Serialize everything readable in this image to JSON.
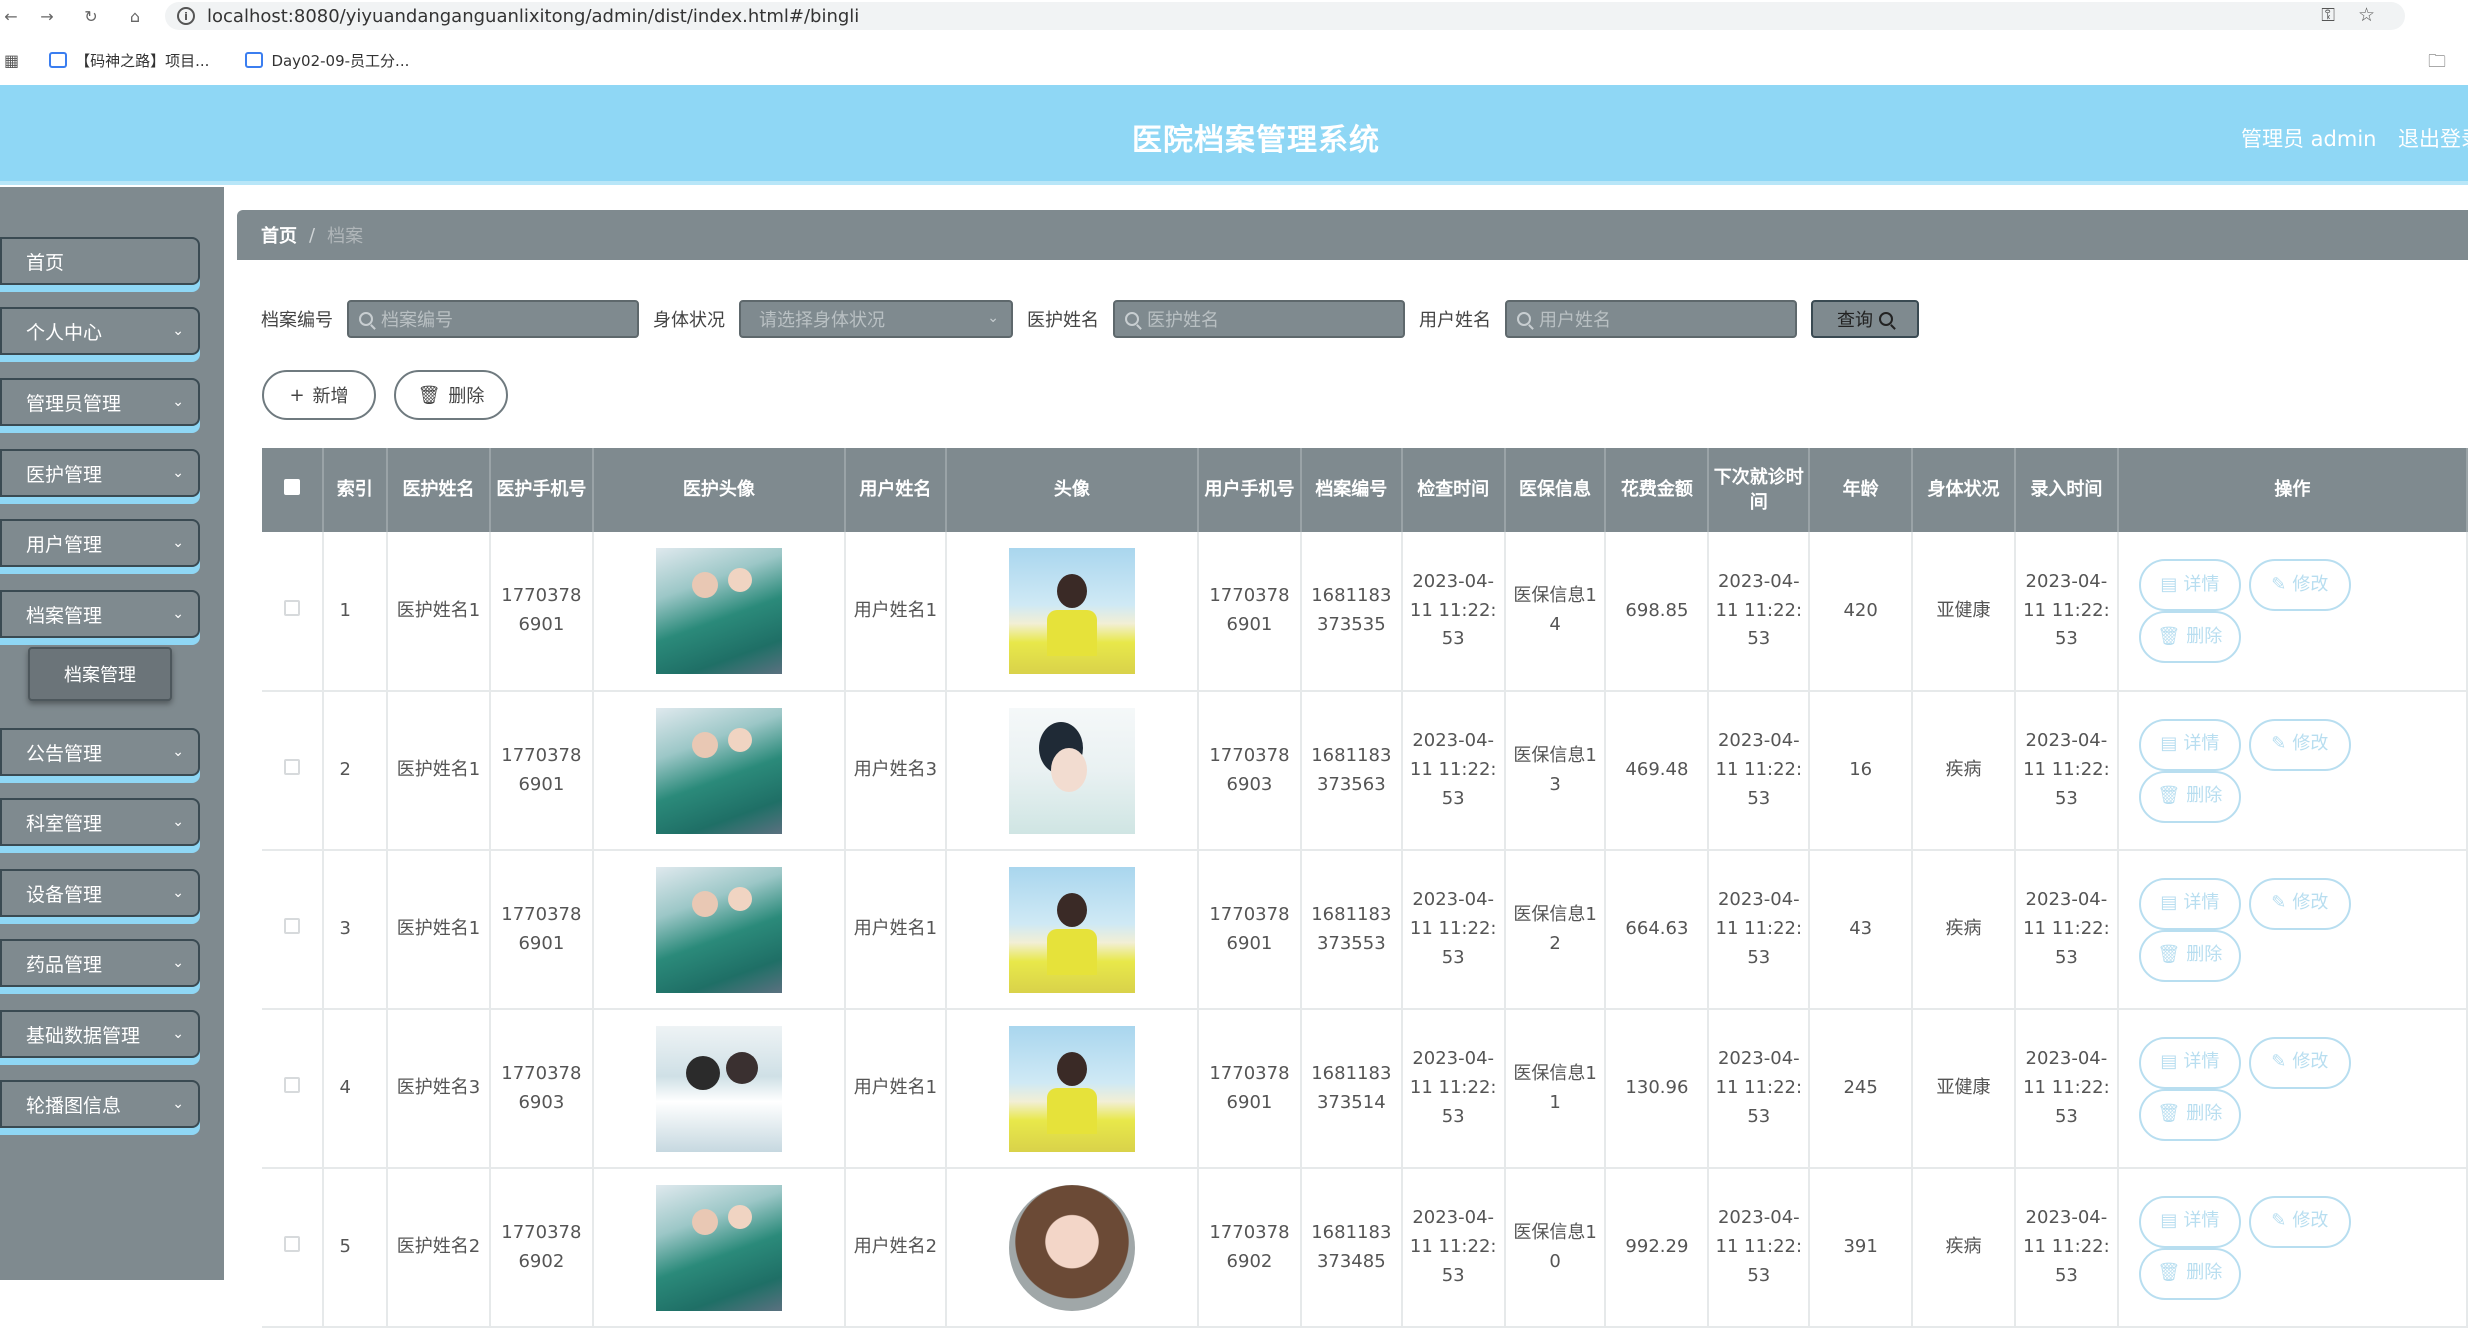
{
  "browser": {
    "url": "localhost:8080/yiyuandanganguanlixitong/admin/dist/index.html#/bingli",
    "bookmarks": [
      "【码神之路】项目...",
      "Day02-09-员工分..."
    ]
  },
  "header": {
    "title": "医院档案管理系统",
    "admin": "管理员 admin",
    "logout": "退出登录"
  },
  "sidebar": {
    "items": [
      {
        "label": "首页",
        "has_chevron": false
      },
      {
        "label": "个人中心",
        "has_chevron": true
      },
      {
        "label": "管理员管理",
        "has_chevron": true
      },
      {
        "label": "医护管理",
        "has_chevron": true
      },
      {
        "label": "用户管理",
        "has_chevron": true
      },
      {
        "label": "档案管理",
        "has_chevron": true
      },
      {
        "label": "公告管理",
        "has_chevron": true
      },
      {
        "label": "科室管理",
        "has_chevron": true
      },
      {
        "label": "设备管理",
        "has_chevron": true
      },
      {
        "label": "药品管理",
        "has_chevron": true
      },
      {
        "label": "基础数据管理",
        "has_chevron": true
      },
      {
        "label": "轮播图信息",
        "has_chevron": true
      }
    ],
    "submenu": {
      "label": "档案管理"
    }
  },
  "breadcrumb": {
    "home": "首页",
    "separator": "/",
    "current": "档案"
  },
  "search": {
    "field1_label": "档案编号",
    "field1_placeholder": "档案编号",
    "field2_label": "身体状况",
    "field2_placeholder": "请选择身体状况",
    "field3_label": "医护姓名",
    "field3_placeholder": "医护姓名",
    "field4_label": "用户姓名",
    "field4_placeholder": "用户姓名",
    "query_label": "查询"
  },
  "actions": {
    "add_label": "新增",
    "delete_label": "删除"
  },
  "table": {
    "headers": {
      "index": "索引",
      "doctor_name": "医护姓名",
      "doctor_phone": "医护手机号",
      "doctor_avatar": "医护头像",
      "user_name": "用户姓名",
      "avatar": "头像",
      "user_phone": "用户手机号",
      "file_no": "档案编号",
      "check_time": "检查时间",
      "insurance": "医保信息",
      "cost": "花费金额",
      "next_visit": "下次就诊时间",
      "age": "年龄",
      "condition": "身体状况",
      "entry_time": "录入时间",
      "ops": "操作"
    },
    "ops": {
      "detail": "详情",
      "edit": "修改",
      "delete": "删除"
    },
    "rows": [
      {
        "index": "1",
        "doctor_name": "医护姓名1",
        "doctor_phone": "17703786901",
        "doctor_img": "doctor",
        "user_name": "用户姓名1",
        "user_img": "girl1",
        "user_phone": "17703786901",
        "file_no": "1681183373535",
        "check_time": "2023-04-11 11:22:53",
        "insurance": "医保信息14",
        "cost": "698.85",
        "next_visit": "2023-04-11 11:22:53",
        "age": "420",
        "condition": "亚健康",
        "entry_time": "2023-04-11 11:22:53"
      },
      {
        "index": "2",
        "doctor_name": "医护姓名1",
        "doctor_phone": "17703786901",
        "doctor_img": "doctor",
        "user_name": "用户姓名3",
        "user_img": "girl2",
        "user_phone": "17703786903",
        "file_no": "1681183373563",
        "check_time": "2023-04-11 11:22:53",
        "insurance": "医保信息13",
        "cost": "469.48",
        "next_visit": "2023-04-11 11:22:53",
        "age": "16",
        "condition": "疾病",
        "entry_time": "2023-04-11 11:22:53"
      },
      {
        "index": "3",
        "doctor_name": "医护姓名1",
        "doctor_phone": "17703786901",
        "doctor_img": "doctor",
        "user_name": "用户姓名1",
        "user_img": "girl1",
        "user_phone": "17703786901",
        "file_no": "1681183373553",
        "check_time": "2023-04-11 11:22:53",
        "insurance": "医保信息12",
        "cost": "664.63",
        "next_visit": "2023-04-11 11:22:53",
        "age": "43",
        "condition": "疾病",
        "entry_time": "2023-04-11 11:22:53"
      },
      {
        "index": "4",
        "doctor_name": "医护姓名3",
        "doctor_phone": "17703786903",
        "doctor_img": "doctor2",
        "user_name": "用户姓名1",
        "user_img": "girl1",
        "user_phone": "17703786901",
        "file_no": "1681183373514",
        "check_time": "2023-04-11 11:22:53",
        "insurance": "医保信息11",
        "cost": "130.96",
        "next_visit": "2023-04-11 11:22:53",
        "age": "245",
        "condition": "亚健康",
        "entry_time": "2023-04-11 11:22:53"
      },
      {
        "index": "5",
        "doctor_name": "医护姓名2",
        "doctor_phone": "17703786902",
        "doctor_img": "doctor",
        "user_name": "用户姓名2",
        "user_img": "girl3",
        "user_phone": "17703786902",
        "file_no": "1681183373485",
        "check_time": "2023-04-11 11:22:53",
        "insurance": "医保信息10",
        "cost": "992.29",
        "next_visit": "2023-04-11 11:22:53",
        "age": "391",
        "condition": "疾病",
        "entry_time": "2023-04-11 11:22:53"
      }
    ]
  },
  "colors": {
    "header_bg": "#8fd7f5",
    "sidebar_bg": "#7f8a8f",
    "op_button": "#b8def0"
  }
}
